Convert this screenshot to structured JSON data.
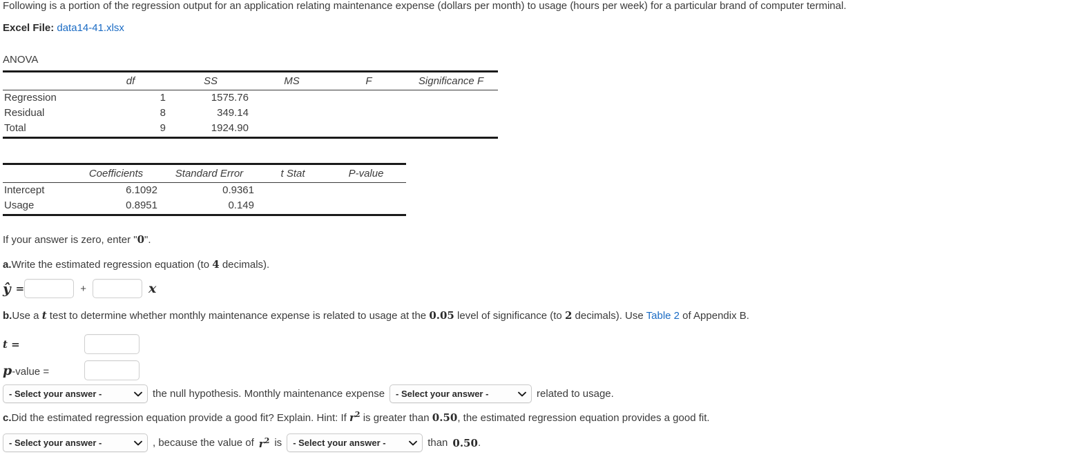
{
  "intro": {
    "text": "Following is a portion of the regression output for an application relating maintenance expense (dollars per month) to usage (hours per week) for a particular brand of computer terminal."
  },
  "excel": {
    "label": "Excel File:",
    "file_link": "data14-41.xlsx"
  },
  "anova": {
    "caption": "ANOVA",
    "columns": [
      "",
      "df",
      "SS",
      "MS",
      "F",
      "Significance F"
    ],
    "rows": [
      {
        "name": "Regression",
        "df": "1",
        "ss": "1575.76",
        "ms": "",
        "f": "",
        "sig": ""
      },
      {
        "name": "Residual",
        "df": "8",
        "ss": "349.14",
        "ms": "",
        "f": "",
        "sig": ""
      },
      {
        "name": "Total",
        "df": "9",
        "ss": "1924.90",
        "ms": "",
        "f": "",
        "sig": ""
      }
    ]
  },
  "coefficients": {
    "columns": [
      "",
      "Coefficients",
      "Standard Error",
      "t Stat",
      "P-value"
    ],
    "rows": [
      {
        "name": "Intercept",
        "coef": "6.1092",
        "se": "0.9361",
        "tstat": "",
        "pvalue": ""
      },
      {
        "name": "Usage",
        "coef": "0.8951",
        "se": "0.149",
        "tstat": "",
        "pvalue": ""
      }
    ]
  },
  "instructions": {
    "zero_note_pre": "If your answer is zero, enter \"",
    "zero_note_value": "0",
    "zero_note_post": "\"."
  },
  "part_a": {
    "marker": "a.",
    "text_pre": "Write the estimated regression equation (to ",
    "decimals": "4",
    "text_post": " decimals).",
    "y_symbol": "ŷ",
    "equals": "=",
    "plus": "+",
    "x_symbol": "x",
    "input_intercept_value": "",
    "input_slope_value": ""
  },
  "part_b": {
    "marker": "b.",
    "text_1": "Use a ",
    "t_symbol": "t",
    "text_2": " test to determine whether monthly maintenance expense is related to usage at the ",
    "alpha": "0.05",
    "text_3": " level of significance (to ",
    "decimals": "2",
    "text_4": " decimals). Use ",
    "table_link": "Table 2",
    "text_5": " of Appendix B.",
    "t_label": "t =",
    "t_value": "",
    "p_label_italic": "p",
    "p_label_rest": "-value =",
    "p_value": "",
    "select_1": "- Select your answer -",
    "mid_text_1": "the null hypothesis. Monthly maintenance expense",
    "select_2": "- Select your answer -",
    "mid_text_2": "related to usage."
  },
  "part_c": {
    "marker": "c.",
    "text_1": "Did the estimated regression equation provide a good fit? Explain. Hint: If ",
    "r_symbol": "r",
    "r_exponent": "2",
    "text_2": " is greater than ",
    "threshold": "0.50",
    "text_3": ", the estimated regression equation provides a good fit.",
    "select_1": "- Select your answer -",
    "mid_text_1": ", because the value of",
    "mid_text_2": "is",
    "select_2": "- Select your answer -",
    "mid_text_3": "than",
    "threshold_2": "0.50",
    "period": "."
  },
  "colors": {
    "link": "#1a6bc4",
    "text": "#3b3b3b",
    "rule": "#1a1a1a",
    "input_border": "#cfcfcf"
  },
  "icons": {
    "chevron": "chevron-down-icon"
  }
}
